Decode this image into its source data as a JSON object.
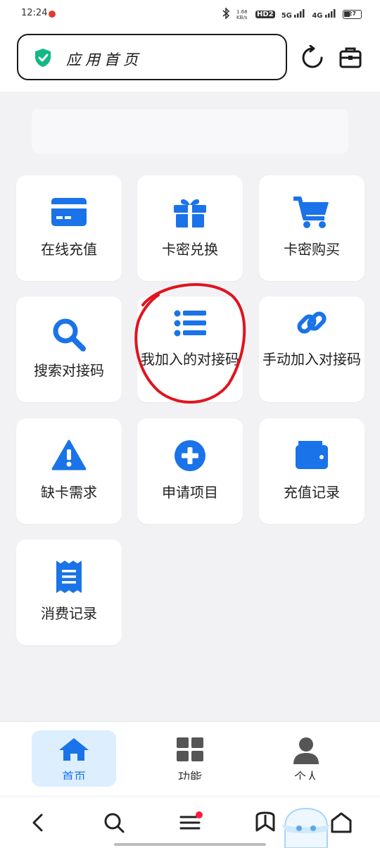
{
  "status_bar": {
    "time": "12:24",
    "network_speed": "1.68 KB/s",
    "hd_label": "HD2",
    "signal_1": "5G",
    "signal_2": "4G",
    "battery": "27"
  },
  "header": {
    "address_text": "应用首页",
    "icons": [
      "shield-check-icon",
      "refresh-icon",
      "toolbox-icon"
    ]
  },
  "tiles": [
    {
      "label": "在线充值",
      "icon": "credit-card-icon"
    },
    {
      "label": "卡密兑换",
      "icon": "gift-icon"
    },
    {
      "label": "卡密购买",
      "icon": "shopping-cart-icon"
    },
    {
      "label": "搜索对接码",
      "icon": "search-icon"
    },
    {
      "label": "我加入的对接码",
      "icon": "list-icon"
    },
    {
      "label": "手动加入对接码",
      "icon": "link-icon"
    },
    {
      "label": "缺卡需求",
      "icon": "warning-icon"
    },
    {
      "label": "申请项目",
      "icon": "plus-circle-icon"
    },
    {
      "label": "充值记录",
      "icon": "wallet-icon"
    },
    {
      "label": "消费记录",
      "icon": "receipt-icon"
    }
  ],
  "bottom_nav": [
    {
      "label": "首页",
      "icon": "home-icon",
      "active": true
    },
    {
      "label": "功能",
      "icon": "grid-icon",
      "active": false
    },
    {
      "label": "个人",
      "icon": "user-icon",
      "active": false
    }
  ],
  "browser_bar": {
    "icons": [
      "back-icon",
      "search-icon",
      "menu-icon",
      "bookmark-icon",
      "home-outline-icon"
    ]
  },
  "colors": {
    "accent": "#1a73e8",
    "annotation": "#e0141e",
    "shield": "#12b886",
    "background": "#f2f2f5"
  }
}
